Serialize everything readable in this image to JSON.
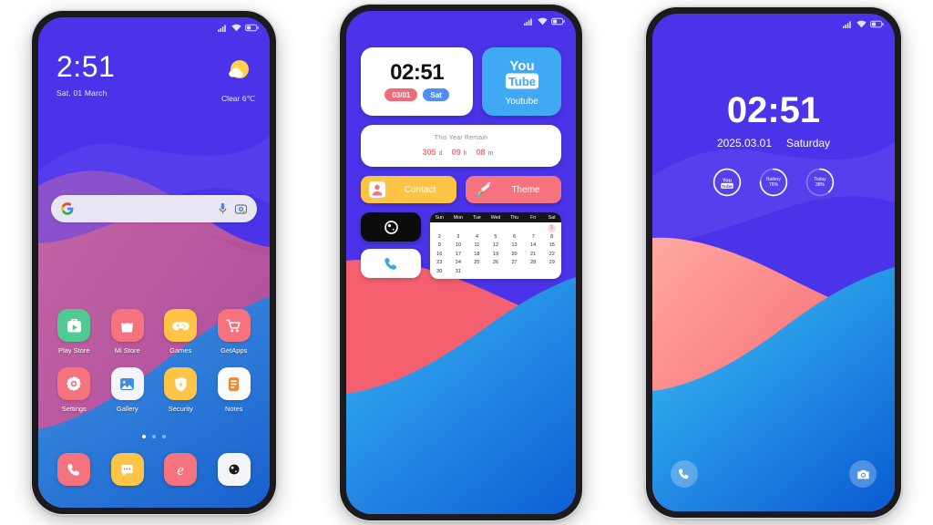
{
  "page": {
    "background": "#ffffff",
    "theme_accent": "#4733e8",
    "title": "MIUI Theme Preview — Three Phone Mockups"
  },
  "phone1": {
    "name": "home-screen",
    "statusbar": {
      "icons": [
        "signal-icon",
        "wifi-icon",
        "battery-icon"
      ]
    },
    "clock": {
      "time": "2:51",
      "date": "Sat, 01 March"
    },
    "weather": {
      "icon": "partly-cloudy-icon",
      "text": "Clear 6℃"
    },
    "search": {
      "engine_icon": "google-g-icon",
      "mic_icon": "microphone-icon",
      "lens_icon": "google-lens-icon",
      "placeholder": ""
    },
    "apps": [
      {
        "label": "Play Store",
        "icon": "play-store-icon",
        "bg": "#4ecb92"
      },
      {
        "label": "Mi Store",
        "icon": "shopping-bag-icon",
        "bg": "#f4737f"
      },
      {
        "label": "Games",
        "icon": "gamepad-icon",
        "bg": "#fdc446"
      },
      {
        "label": "GetApps",
        "icon": "shopping-cart-icon",
        "bg": "#f4737f"
      },
      {
        "label": "Settings",
        "icon": "gear-icon",
        "bg": "#f4737f"
      },
      {
        "label": "Gallery",
        "icon": "photo-icon",
        "bg": "#f4f5fa"
      },
      {
        "label": "Security",
        "icon": "shield-icon",
        "bg": "#fdc446"
      },
      {
        "label": "Notes",
        "icon": "notes-icon",
        "bg": "#fbfbfd"
      }
    ],
    "page_dots": {
      "count": 3,
      "active_index": 0
    },
    "dock": [
      {
        "label": "Phone",
        "icon": "phone-icon",
        "bg": "#f4737f"
      },
      {
        "label": "Messages",
        "icon": "message-icon",
        "bg": "#fdc446"
      },
      {
        "label": "Browser",
        "icon": "browser-e-icon",
        "bg": "#f4737f"
      },
      {
        "label": "Camera",
        "icon": "camera-lens-icon",
        "bg": "#f4f5fa"
      }
    ]
  },
  "phone2": {
    "name": "widgets-screen",
    "statusbar": {
      "icons": [
        "signal-icon",
        "wifi-icon",
        "battery-icon"
      ]
    },
    "clock_widget": {
      "time": "02:51",
      "date_pill": "03/01",
      "day_pill": "Sat"
    },
    "youtube_widget": {
      "label": "Youtube",
      "brand_top": "You",
      "brand_bottom": "Tube",
      "bg": "#3fa9f5"
    },
    "year_widget": {
      "title": "This Year Remain",
      "days": "305",
      "days_unit": "d",
      "hours": "09",
      "hours_unit": "h",
      "minutes": "08",
      "minutes_unit": "m"
    },
    "shortcuts": [
      {
        "label": "Contact",
        "icon": "contact-person-icon",
        "bg": "#fdc446"
      },
      {
        "label": "Theme",
        "icon": "paintbrush-icon",
        "bg": "#f4737f"
      }
    ],
    "tiles": [
      {
        "label": "Camera",
        "icon": "camera-lens-icon",
        "bg": "#0c0c0c"
      },
      {
        "label": "Phone",
        "icon": "phone-icon",
        "bg": "#ffffff"
      }
    ],
    "calendar": {
      "weekdays": [
        "Sun",
        "Mon",
        "Tue",
        "Wed",
        "Thu",
        "Fri",
        "Sat"
      ],
      "today": 1,
      "cells": [
        "",
        "",
        "",
        "",
        "",
        "",
        "1",
        "2",
        "3",
        "4",
        "5",
        "6",
        "7",
        "8",
        "9",
        "10",
        "11",
        "12",
        "13",
        "14",
        "15",
        "16",
        "17",
        "18",
        "19",
        "20",
        "21",
        "22",
        "23",
        "24",
        "25",
        "26",
        "27",
        "28",
        "29",
        "30",
        "31",
        "",
        "",
        "",
        "",
        ""
      ]
    }
  },
  "phone3": {
    "name": "lock-screen",
    "statusbar": {
      "icons": [
        "signal-icon",
        "wifi-icon",
        "battery-icon"
      ]
    },
    "lock": {
      "time": "02:51",
      "date": "2025.03.01",
      "weekday": "Saturday"
    },
    "rings": [
      {
        "type": "youtube",
        "icon": "youtube-icon",
        "label": "",
        "value": "",
        "progress": 100
      },
      {
        "type": "battery",
        "icon": "",
        "label": "Battery",
        "value": "76%",
        "progress": 76
      },
      {
        "type": "today",
        "icon": "",
        "label": "Today",
        "value": "38%",
        "progress": 38
      }
    ],
    "dock": [
      {
        "label": "Phone",
        "icon": "phone-icon"
      },
      {
        "label": "Camera",
        "icon": "camera-icon"
      }
    ]
  }
}
